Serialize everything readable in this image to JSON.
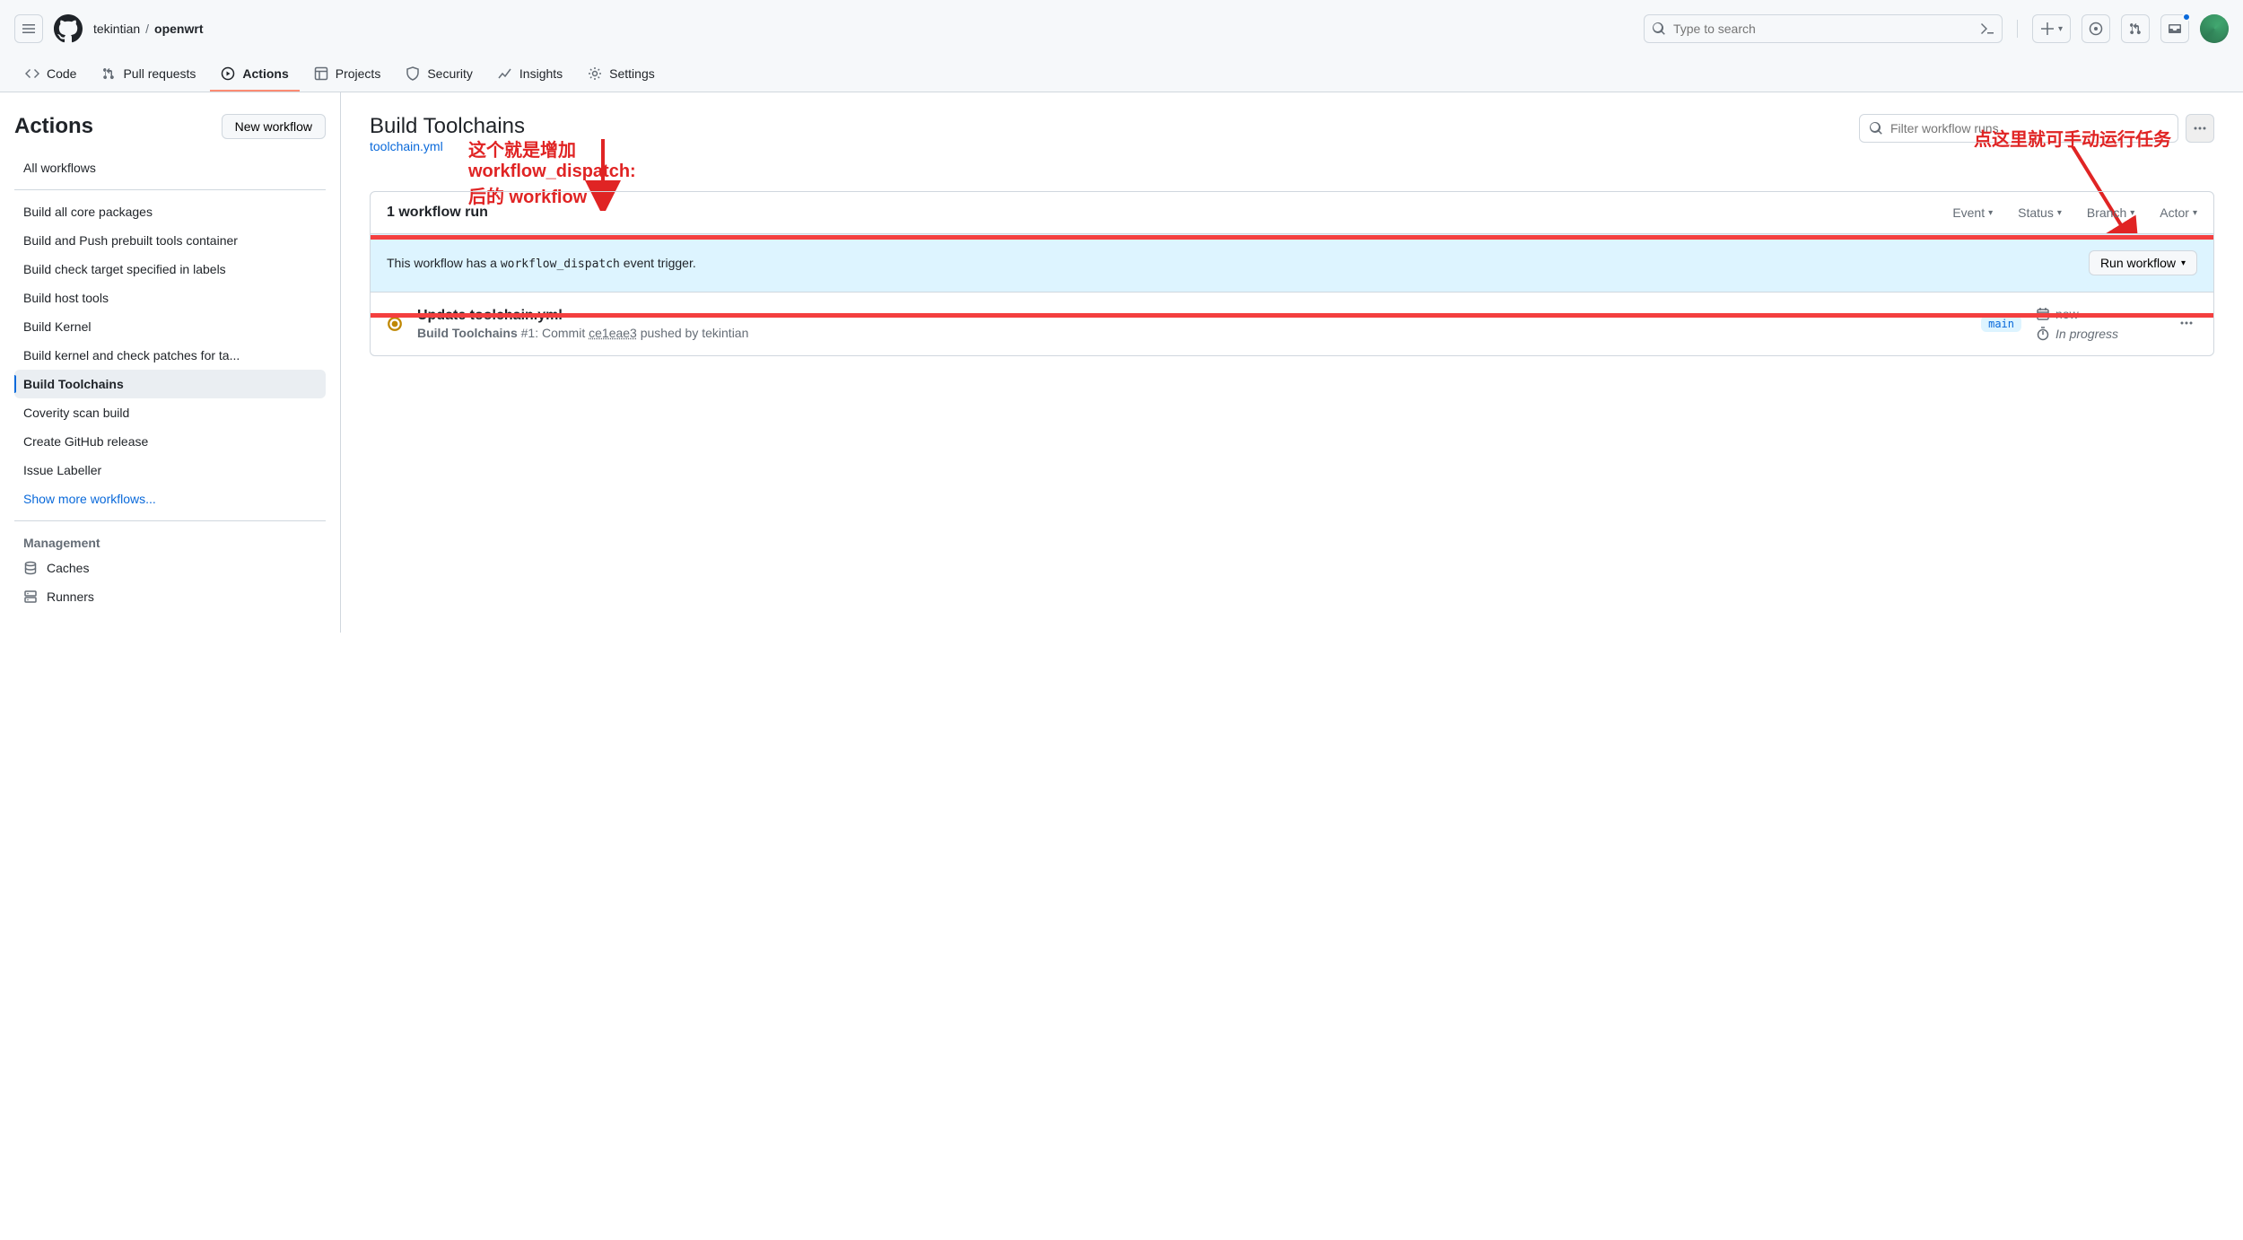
{
  "header": {
    "owner": "tekintian",
    "repo": "openwrt",
    "search_placeholder": "Type to search"
  },
  "repo_nav": {
    "code": "Code",
    "pulls": "Pull requests",
    "actions": "Actions",
    "projects": "Projects",
    "security": "Security",
    "insights": "Insights",
    "settings": "Settings"
  },
  "sidebar": {
    "title": "Actions",
    "new_workflow": "New workflow",
    "all_workflows": "All workflows",
    "items": [
      "Build all core packages",
      "Build and Push prebuilt tools container",
      "Build check target specified in labels",
      "Build host tools",
      "Build Kernel",
      "Build kernel and check patches for ta...",
      "Build Toolchains",
      "Coverity scan build",
      "Create GitHub release",
      "Issue Labeller"
    ],
    "active_index": 6,
    "show_more": "Show more workflows...",
    "management_label": "Management",
    "caches": "Caches",
    "runners": "Runners"
  },
  "main": {
    "title": "Build Toolchains",
    "wf_file": "toolchain.yml",
    "filter_placeholder": "Filter workflow runs",
    "runs_count": "1 workflow run",
    "filters": {
      "event": "Event",
      "status": "Status",
      "branch": "Branch",
      "actor": "Actor"
    },
    "dispatch": {
      "msg_pre": "This workflow has a ",
      "msg_code": "workflow_dispatch",
      "msg_post": " event trigger.",
      "button": "Run workflow"
    },
    "run": {
      "title": "Update toolchain.yml",
      "wf_name": "Build Toolchains",
      "run_num": "#1",
      "commit_word": "Commit",
      "sha": "ce1eae3",
      "pushed_by_pre": "pushed by",
      "actor": "tekintian",
      "branch": "main",
      "time": "now",
      "progress": "In progress"
    }
  },
  "annotations": {
    "a1": "这个就是增加 workflow_dispatch: 后的 workflow",
    "a2": "点这里就可手动运行任务"
  }
}
